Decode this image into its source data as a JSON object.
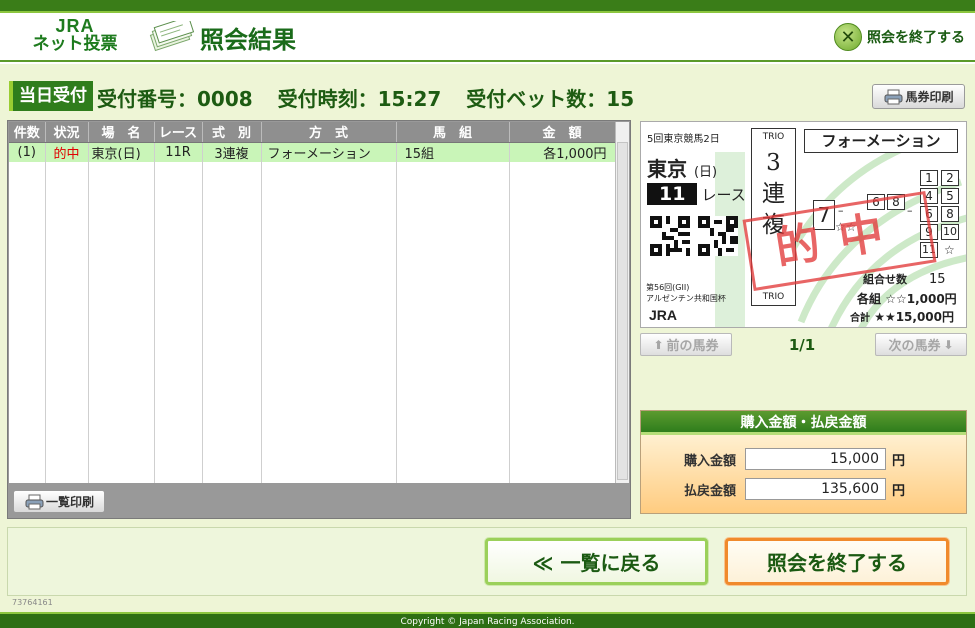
{
  "header": {
    "logo_top": "JRA",
    "logo_bottom": "ネット投票",
    "title": "照会結果",
    "exit_label": "照会を終了する"
  },
  "receipt": {
    "badge": "当日受付",
    "number_text": "受付番号：0008",
    "time_text": "受付時刻：15:27",
    "bets_text": "受付ベット数：15",
    "print_ticket_label": "馬券印刷"
  },
  "table": {
    "columns": [
      "件数",
      "状況",
      "場　名",
      "レース",
      "式　別",
      "方　式",
      "馬　組",
      "金　額"
    ],
    "rows": [
      {
        "count": "(1)",
        "status": "的中",
        "venue": "東京(日)",
        "race": "11R",
        "type": "3連複",
        "method": "フォーメーション",
        "combo": "15組",
        "amount": "各1,000円"
      }
    ],
    "print_list_label": "一覧印刷"
  },
  "ticket": {
    "header": "5回東京競馬2日",
    "venue": "東京",
    "day": "(日)",
    "race_number": "11",
    "race_label": "レース",
    "bet_type_en": "TRIO",
    "bet_type_chars": [
      "3",
      "連",
      "複"
    ],
    "method": "フォーメーション",
    "first": "7",
    "second": [
      "6",
      "8"
    ],
    "third": [
      "1",
      "2",
      "4",
      "5",
      "6",
      "8",
      "9",
      "10",
      "11"
    ],
    "stamp": "的中",
    "combo_label": "組合せ数",
    "combo_count": "15",
    "each_label": "各組",
    "each_amount": "☆☆1,000円",
    "total_label": "合計",
    "total_amount": "★★15,000円",
    "event_line1": "第56回(GII)",
    "event_line2": "アルゼンチン共和国杯",
    "org": "JRA",
    "star_marks": "☆☆",
    "third_star": "☆",
    "dash": "–"
  },
  "pager": {
    "prev_label": "前の馬券",
    "next_label": "次の馬券",
    "current": "1/1"
  },
  "amounts": {
    "title": "購入金額・払戻金額",
    "purchase_label": "購入金額",
    "purchase_value": "15,000",
    "payout_label": "払戻金額",
    "payout_value": "135,600",
    "yen": "円"
  },
  "actions": {
    "back_label": "≪ 一覧に戻る",
    "end_label": "照会を終了する"
  },
  "footer": {
    "code": "73764161",
    "copyright": "Copyright © Japan Racing Association."
  },
  "colors": {
    "brand_green": "#2f7d1c",
    "hit_red": "#e23a3a",
    "accent_orange": "#f08a2c"
  }
}
